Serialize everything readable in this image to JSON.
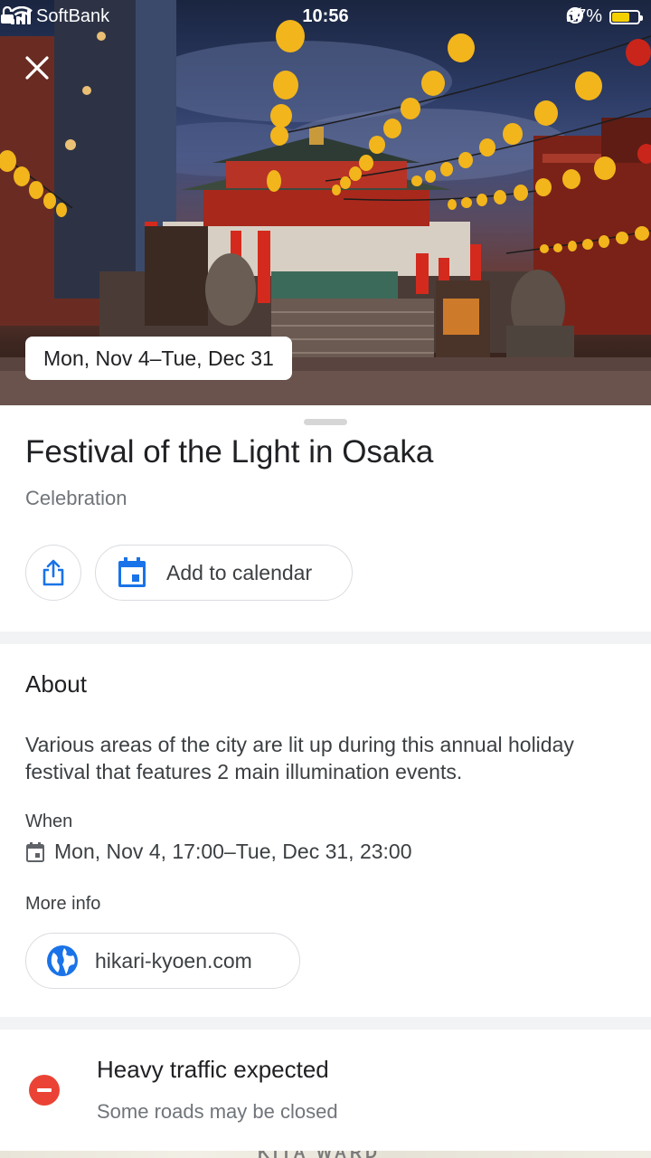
{
  "status_bar": {
    "carrier": "SoftBank",
    "time": "10:56",
    "battery": "67%",
    "battery_level": 0.67,
    "icons": [
      "signal-icon",
      "wifi-icon",
      "lock-icon",
      "orientation-lock-icon",
      "location-arrow-icon",
      "headphones-icon",
      "battery-icon"
    ]
  },
  "hero": {
    "close_icon": "close-icon",
    "date_range": "Mon, Nov 4–Tue, Dec 31"
  },
  "event": {
    "title": "Festival of the Light in Osaka",
    "category": "Celebration"
  },
  "actions": {
    "share_icon": "share-icon",
    "calendar_icon": "calendar-icon",
    "add_to_calendar": "Add to calendar"
  },
  "about": {
    "heading": "About",
    "description": "Various areas of the city are lit up during this annual holiday festival that features 2 main illumination events.",
    "when_label": "When",
    "when_value": "Mon, Nov 4, 17:00–Tue, Dec 31, 23:00",
    "more_info_label": "More info",
    "website": "hikari-kyoen.com"
  },
  "traffic": {
    "title": "Heavy traffic expected",
    "subtitle": "Some roads may be closed"
  },
  "map": {
    "label": "KITA WARD"
  },
  "colors": {
    "accent_blue": "#1a73e8",
    "alert_red": "#ea4335",
    "battery_yellow": "#f5d000"
  }
}
